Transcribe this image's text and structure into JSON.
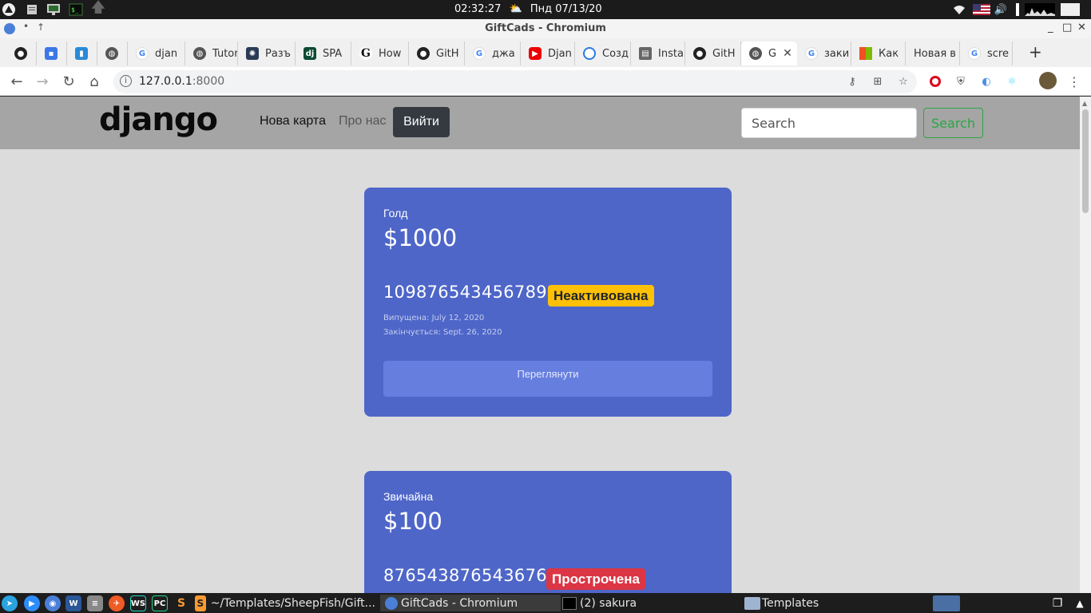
{
  "system_panel": {
    "time": "02:32:27",
    "date": "Пнд 07/13/20",
    "icons": [
      "distro-icon",
      "files-icon",
      "monitor-icon",
      "terminal-icon",
      "arrow-up-icon"
    ],
    "tray": [
      "wifi-icon",
      "us-flag-icon",
      "volume-icon",
      "network-graph-icon"
    ]
  },
  "window": {
    "title": "GiftCads - Chromium",
    "controls": [
      "_",
      "□",
      "✕"
    ]
  },
  "tabs": [
    {
      "label": "",
      "favicon": "github-icon"
    },
    {
      "label": "",
      "favicon": "contacts-icon"
    },
    {
      "label": "",
      "favicon": "trello-icon"
    },
    {
      "label": "",
      "favicon": "globe-icon"
    },
    {
      "label": "djan",
      "favicon": "google-icon"
    },
    {
      "label": "Tutor",
      "favicon": "globe-icon"
    },
    {
      "label": "Разъ",
      "favicon": "react-icon"
    },
    {
      "label": "SPA",
      "favicon": "django-icon"
    },
    {
      "label": "How",
      "favicon": "google-g-icon"
    },
    {
      "label": "GitH",
      "favicon": "github-icon"
    },
    {
      "label": "джа",
      "favicon": "google-icon"
    },
    {
      "label": "Djan",
      "favicon": "youtube-icon"
    },
    {
      "label": "Созд",
      "favicon": "spinner-icon"
    },
    {
      "label": "Insta",
      "favicon": "book-icon"
    },
    {
      "label": "GitH",
      "favicon": "github-icon"
    },
    {
      "label": "G",
      "favicon": "globe-icon",
      "active": true
    },
    {
      "label": "заки",
      "favicon": "google-icon"
    },
    {
      "label": "Как",
      "favicon": "microsoft-icon"
    },
    {
      "label": "Новая в",
      "favicon": ""
    },
    {
      "label": "scre",
      "favicon": "google-icon"
    }
  ],
  "toolbar": {
    "url_host": "127.0.0.1",
    "url_port": ":8000"
  },
  "site": {
    "logo": "django",
    "nav": {
      "new_card": "Нова карта",
      "about": "Про нас",
      "logout": "Вийти"
    },
    "search": {
      "placeholder": "Search",
      "button": "Search"
    },
    "colors": {
      "navbar": "#a5a5a5",
      "page_bg": "#dcdcdc",
      "card_bg": "#4e66c8",
      "badge_inactive": "#ffc107",
      "badge_expired": "#dc3545",
      "search_btn": "#28a745"
    },
    "cards": [
      {
        "type": "Голд",
        "amount": "$1000",
        "number": "1098765434567898",
        "status": "Неактивована",
        "issued": "Випущена: July 12, 2020",
        "expires": "Закінчується: Sept. 26, 2020",
        "view_button": "Переглянути"
      },
      {
        "type": "Звичайна",
        "amount": "$100",
        "number": "8765438765436761",
        "status": "Прострочена"
      }
    ]
  },
  "taskbar": {
    "launchers": [
      "telegram-icon",
      "zoom-icon",
      "chromium-icon",
      "word-icon",
      "database-icon",
      "postman-icon",
      "webstorm-icon",
      "pycharm-icon",
      "sublime-icon"
    ],
    "tasks": [
      {
        "label": "~/Templates/SheepFish/Gift...",
        "icon": "sublime-icon"
      },
      {
        "label": "GiftCads - Chromium",
        "icon": "chromium-icon",
        "active": true
      },
      {
        "label": "(2) sakura",
        "icon": "terminal-icon"
      },
      {
        "label": "Templates",
        "icon": "folder-icon"
      }
    ]
  }
}
